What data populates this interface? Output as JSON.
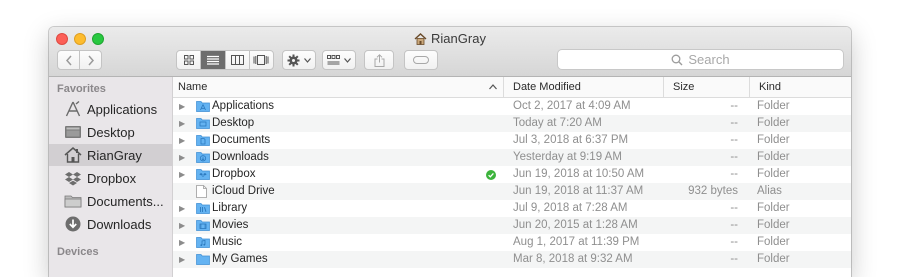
{
  "window": {
    "title": "RianGray",
    "search_placeholder": "Search"
  },
  "sidebar": {
    "favorites_header": "Favorites",
    "items": [
      {
        "label": "Applications",
        "icon": "applications-icon"
      },
      {
        "label": "Desktop",
        "icon": "desktop-icon"
      },
      {
        "label": "RianGray",
        "icon": "home-icon",
        "selected": true
      },
      {
        "label": "Dropbox",
        "icon": "dropbox-icon"
      },
      {
        "label": "Documents...",
        "icon": "documents-icon"
      },
      {
        "label": "Downloads",
        "icon": "downloads-icon"
      }
    ],
    "devices_header": "Devices"
  },
  "columns": {
    "name": "Name",
    "date": "Date Modified",
    "size": "Size",
    "kind": "Kind"
  },
  "files": [
    {
      "name": "Applications",
      "date": "Oct 2, 2017 at 4:09 AM",
      "size": "--",
      "kind": "Folder"
    },
    {
      "name": "Desktop",
      "date": "Today at 7:20 AM",
      "size": "--",
      "kind": "Folder"
    },
    {
      "name": "Documents",
      "date": "Jul 3, 2018 at 6:37 PM",
      "size": "--",
      "kind": "Folder"
    },
    {
      "name": "Downloads",
      "date": "Yesterday at 9:19 AM",
      "size": "--",
      "kind": "Folder"
    },
    {
      "name": "Dropbox",
      "date": "Jun 19, 2018 at 10:50 AM",
      "size": "--",
      "kind": "Folder"
    },
    {
      "name": "iCloud Drive",
      "date": "Jun 19, 2018 at 11:37 AM",
      "size": "932 bytes",
      "kind": "Alias"
    },
    {
      "name": "Library",
      "date": "Jul 9, 2018 at 7:28 AM",
      "size": "--",
      "kind": "Folder"
    },
    {
      "name": "Movies",
      "date": "Jun 20, 2015 at 1:28 AM",
      "size": "--",
      "kind": "Folder"
    },
    {
      "name": "Music",
      "date": "Aug 1, 2017 at 11:39 PM",
      "size": "--",
      "kind": "Folder"
    },
    {
      "name": "My Games",
      "date": "Mar 8, 2018 at 9:32 AM",
      "size": "--",
      "kind": "Folder"
    }
  ],
  "colors": {
    "folder": "#5fb0f0",
    "sidebar_bg": "#e9e6e9",
    "selected_sidebar": "#d2cfd2",
    "sync_badge": "#3cb33c"
  }
}
